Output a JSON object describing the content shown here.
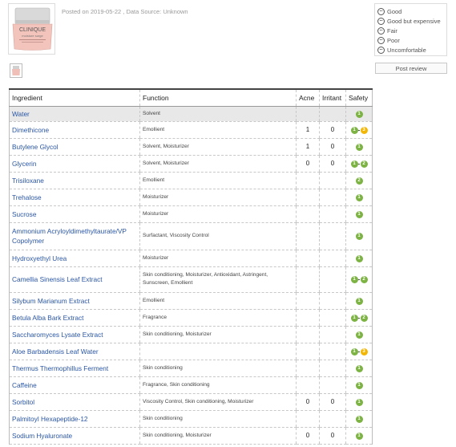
{
  "product": {
    "brand": "CLINIQUE",
    "name_line": "moisture surge",
    "posted": "Posted on 2019-05-22 , Data Source: Unknown"
  },
  "legend": {
    "items": [
      {
        "label": "Good",
        "icon": "good-face-icon"
      },
      {
        "label": "Good but expensive",
        "icon": "expensive-face-icon"
      },
      {
        "label": "Fair",
        "icon": "fair-face-icon"
      },
      {
        "label": "Poor",
        "icon": "poor-face-icon"
      },
      {
        "label": "Uncomfortable",
        "icon": "uncomfortable-face-icon"
      }
    ]
  },
  "post_review_label": "Post review",
  "colors": {
    "safe": "#7cb342",
    "moderate": "#f2b705",
    "link": "#2a56a4"
  },
  "table": {
    "headers": {
      "ingredient": "Ingredient",
      "function": "Function",
      "acne": "Acne",
      "irritant": "Irritant",
      "safety": "Safety"
    },
    "rows": [
      {
        "ingredient": "Water",
        "function": "Solvent",
        "acne": "",
        "irritant": "",
        "safety": [
          {
            "v": "1",
            "c": "safe"
          }
        ]
      },
      {
        "ingredient": "Dimethicone",
        "function": "Emollient",
        "acne": "1",
        "irritant": "0",
        "safety": [
          {
            "v": "1",
            "c": "safe"
          },
          {
            "v": "3",
            "c": "moderate"
          }
        ]
      },
      {
        "ingredient": "Butylene Glycol",
        "function": "Solvent, Moisturizer",
        "acne": "1",
        "irritant": "0",
        "safety": [
          {
            "v": "1",
            "c": "safe"
          }
        ]
      },
      {
        "ingredient": "Glycerin",
        "function": "Solvent, Moisturizer",
        "acne": "0",
        "irritant": "0",
        "safety": [
          {
            "v": "1",
            "c": "safe"
          },
          {
            "v": "2",
            "c": "safe"
          }
        ]
      },
      {
        "ingredient": "Trisiloxane",
        "function": "Emollient",
        "acne": "",
        "irritant": "",
        "safety": [
          {
            "v": "2",
            "c": "safe"
          }
        ]
      },
      {
        "ingredient": "Trehalose",
        "function": "Moisturizer",
        "acne": "",
        "irritant": "",
        "safety": [
          {
            "v": "1",
            "c": "safe"
          }
        ]
      },
      {
        "ingredient": "Sucrose",
        "function": "Moisturizer",
        "acne": "",
        "irritant": "",
        "safety": [
          {
            "v": "1",
            "c": "safe"
          }
        ]
      },
      {
        "ingredient": "Ammonium Acryloyldimethyltaurate/VP Copolymer",
        "function": "Surfactant, Viscosity Control",
        "acne": "",
        "irritant": "",
        "safety": [
          {
            "v": "1",
            "c": "safe"
          }
        ]
      },
      {
        "ingredient": "Hydroxyethyl Urea",
        "function": "Moisturizer",
        "acne": "",
        "irritant": "",
        "safety": [
          {
            "v": "1",
            "c": "safe"
          }
        ]
      },
      {
        "ingredient": "Camellia Sinensis Leaf Extract",
        "function": "Skin conditioning, Moisturizer, Antioxidant, Astringent, Sunscreen, Emollient",
        "acne": "",
        "irritant": "",
        "safety": [
          {
            "v": "1",
            "c": "safe"
          },
          {
            "v": "2",
            "c": "safe"
          }
        ]
      },
      {
        "ingredient": "Silybum Marianum Extract",
        "function": "Emollient",
        "acne": "",
        "irritant": "",
        "safety": [
          {
            "v": "1",
            "c": "safe"
          }
        ]
      },
      {
        "ingredient": "Betula Alba Bark Extract",
        "function": "Fragrance",
        "acne": "",
        "irritant": "",
        "safety": [
          {
            "v": "1",
            "c": "safe"
          },
          {
            "v": "2",
            "c": "safe"
          }
        ]
      },
      {
        "ingredient": "Saccharomyces Lysate Extract",
        "function": "Skin conditioning, Moisturizer",
        "acne": "",
        "irritant": "",
        "safety": [
          {
            "v": "1",
            "c": "safe"
          }
        ]
      },
      {
        "ingredient": "Aloe Barbadensis Leaf Water",
        "function": "",
        "acne": "",
        "irritant": "",
        "safety": [
          {
            "v": "1",
            "c": "safe"
          },
          {
            "v": "3",
            "c": "moderate"
          }
        ]
      },
      {
        "ingredient": "Thermus Thermophillus Ferment",
        "function": "Skin conditioning",
        "acne": "",
        "irritant": "",
        "safety": [
          {
            "v": "1",
            "c": "safe"
          }
        ]
      },
      {
        "ingredient": "Caffeine",
        "function": "Fragrance, Skin conditioning",
        "acne": "",
        "irritant": "",
        "safety": [
          {
            "v": "1",
            "c": "safe"
          }
        ]
      },
      {
        "ingredient": "Sorbitol",
        "function": "Viscosity Control, Skin conditioning, Moisturizer",
        "acne": "0",
        "irritant": "0",
        "safety": [
          {
            "v": "1",
            "c": "safe"
          }
        ]
      },
      {
        "ingredient": "Palmitoyl Hexapeptide-12",
        "function": "Skin conditioning",
        "acne": "",
        "irritant": "",
        "safety": [
          {
            "v": "1",
            "c": "safe"
          }
        ]
      },
      {
        "ingredient": "Sodium Hyaluronate",
        "function": "Skin conditioning, Moisturizer",
        "acne": "0",
        "irritant": "0",
        "safety": [
          {
            "v": "1",
            "c": "safe"
          }
        ]
      }
    ]
  }
}
